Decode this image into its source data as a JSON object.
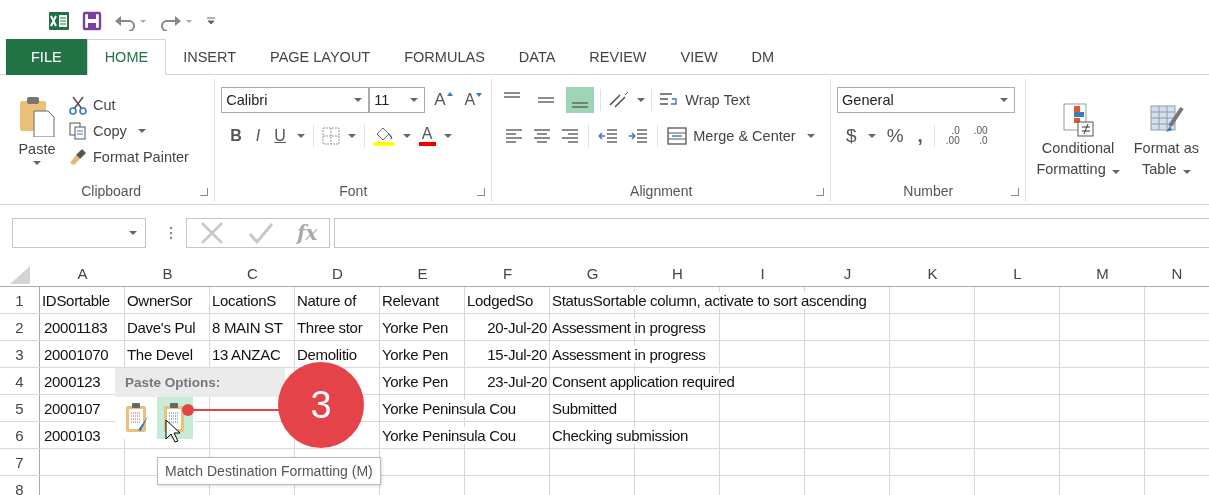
{
  "tabs": [
    {
      "label": "FILE",
      "kind": "file",
      "selected": false
    },
    {
      "label": "HOME",
      "kind": "tab",
      "selected": true
    },
    {
      "label": "INSERT",
      "kind": "tab",
      "selected": false
    },
    {
      "label": "PAGE LAYOUT",
      "kind": "tab",
      "selected": false
    },
    {
      "label": "FORMULAS",
      "kind": "tab",
      "selected": false
    },
    {
      "label": "DATA",
      "kind": "tab",
      "selected": false
    },
    {
      "label": "REVIEW",
      "kind": "tab",
      "selected": false
    },
    {
      "label": "VIEW",
      "kind": "tab",
      "selected": false
    },
    {
      "label": "DM",
      "kind": "tab",
      "selected": false
    }
  ],
  "clipboard": {
    "paste": "Paste",
    "cut": "Cut",
    "copy": "Copy",
    "format_painter": "Format Painter",
    "label": "Clipboard"
  },
  "font": {
    "name": "Calibri",
    "size": "11",
    "grow": "A",
    "shrink": "A",
    "bold": "B",
    "italic": "I",
    "underline": "U",
    "font_color": "A",
    "label": "Font"
  },
  "alignment": {
    "vertical": [
      {
        "kind": "top",
        "selected": false
      },
      {
        "kind": "middle",
        "selected": false
      },
      {
        "kind": "bottom",
        "selected": true
      }
    ],
    "wrap_text": "Wrap Text",
    "merge": "Merge & Center",
    "label": "Alignment"
  },
  "number": {
    "format": "General",
    "currency": "$",
    "percent": "%",
    "comma": ",",
    "increase_decimal": [
      ".0",
      ".00"
    ],
    "decrease_decimal": [
      ".00",
      ".0"
    ],
    "label": "Number"
  },
  "styles": [
    {
      "kind": "conditional",
      "lines": [
        "Conditional",
        "Formatting"
      ]
    },
    {
      "kind": "table",
      "lines": [
        "Format as",
        "Table"
      ]
    }
  ],
  "formula_bar": {
    "function": "fx"
  },
  "columns": [
    "A",
    "B",
    "C",
    "D",
    "E",
    "F",
    "G",
    "H",
    "I",
    "J",
    "K",
    "L",
    "M",
    "N"
  ],
  "rows": [
    {
      "number": "1",
      "cells": {
        "A": "IDSortable",
        "B": "OwnerSor",
        "C": "LocationS",
        "D": "Nature of",
        "E": "Relevant",
        "F": "LodgedSo",
        "G": "StatusSortable column, activate to sort ascending"
      }
    },
    {
      "number": "2",
      "cells": {
        "A": "20001183",
        "B": "Dave's Pul",
        "C": "8 MAIN ST",
        "D": "Three stor",
        "E": "Yorke Pen",
        "F": "20-Jul-20",
        "G": "Assessment in progress"
      }
    },
    {
      "number": "3",
      "cells": {
        "A": "20001070",
        "B": "The Devel",
        "C": "13 ANZAC",
        "D": "Demolitio",
        "E": "Yorke Pen",
        "F": "15-Jul-20",
        "G": "Assessment in progress"
      }
    },
    {
      "number": "4",
      "cells": {
        "A": "2000123",
        "E": "Yorke Pen",
        "F": "23-Jul-20",
        "G": "Consent application required"
      }
    },
    {
      "number": "5",
      "cells": {
        "A": "2000107",
        "E": "Yorke Peninsula Cou",
        "G": "Submitted"
      }
    },
    {
      "number": "6",
      "cells": {
        "A": "2000103",
        "E": "Yorke Peninsula Cou",
        "G": "Checking submission"
      }
    },
    {
      "number": "7"
    },
    {
      "number": "8"
    }
  ],
  "paste_options": {
    "title": "Paste Options:",
    "options": [
      {
        "kind": "keep_source",
        "selected": false
      },
      {
        "kind": "destination",
        "selected": true
      }
    ],
    "tooltip": "Match Destination Formatting (M)"
  },
  "callout": {
    "number": "3"
  }
}
